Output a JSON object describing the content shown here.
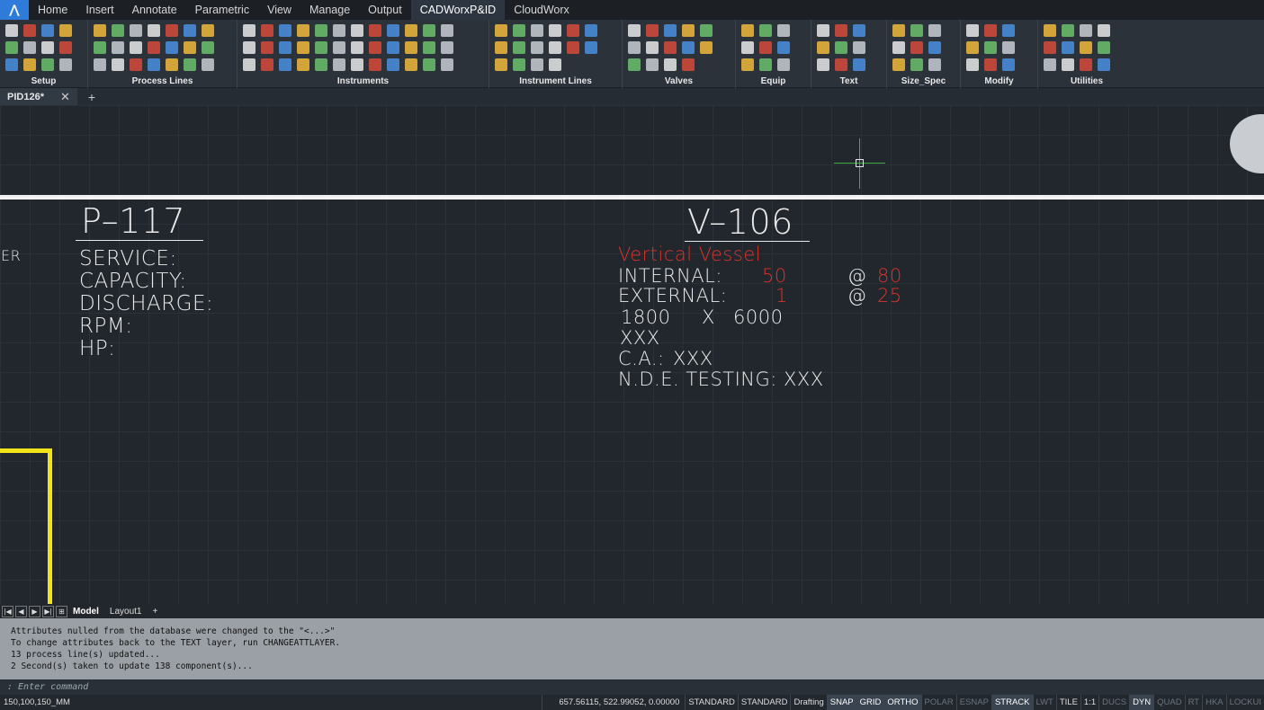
{
  "menu": {
    "logo": "⋀",
    "tabs": [
      "Home",
      "Insert",
      "Annotate",
      "Parametric",
      "View",
      "Manage",
      "Output",
      "CADWorxP&ID",
      "CloudWorx"
    ],
    "active_tab": "CADWorxP&ID"
  },
  "ribbon": {
    "groups": [
      "Setup",
      "Process Lines",
      "Instruments",
      "Instrument Lines",
      "Valves",
      "Equip",
      "Text",
      "Size_Spec",
      "Modify",
      "Utilities"
    ]
  },
  "doc_tabs": {
    "active": "PID126*",
    "close": "✕",
    "add": "+"
  },
  "drawing": {
    "pump": {
      "tag": "P–117",
      "lines": [
        "SERVICE:",
        "CAPACITY:",
        "DISCHARGE:",
        "RPM:",
        "HP:"
      ]
    },
    "left_fragment": "ER",
    "vessel": {
      "tag": "V–106",
      "type": "Vertical Vessel",
      "internal_label": "INTERNAL:",
      "internal_value": "50",
      "internal_at": "@",
      "internal_temp": "80",
      "external_label": "EXTERNAL:",
      "external_value": "1",
      "external_at": "@",
      "external_temp": "25",
      "dim_a": "1800",
      "dim_x": "X",
      "dim_b": "6000",
      "material": "XXX",
      "ca_label": "C.A.:",
      "ca_value": "XXX",
      "nde_label": "N.D.E. TESTING:",
      "nde_value": "XXX"
    },
    "colors": {
      "red": "#d9342b",
      "yellow": "#f2e21a",
      "white": "#e9e9e9",
      "crosshair": "#3fae3f"
    }
  },
  "layout_tabs": {
    "nav": [
      "|◀",
      "◀",
      "▶",
      "▶|",
      "⊞"
    ],
    "tabs": [
      "Model",
      "Layout1"
    ],
    "add": "+"
  },
  "command_history": [
    "Attributes nulled from the database were changed to the \"<...>\"",
    "To change attributes back to the TEXT layer, run CHANGEATTLAYER.",
    "13 process line(s) updated...",
    "2 Second(s) taken to update 138 component(s)..."
  ],
  "command_prompt": ": Enter command",
  "status": {
    "spec": "150,100,150_MM",
    "coords": "657.56115, 522.99052, 0.00000",
    "items": [
      {
        "label": "STANDARD",
        "state": "text"
      },
      {
        "label": "STANDARD",
        "state": "text"
      },
      {
        "label": "Drafting",
        "state": "text"
      },
      {
        "label": "SNAP",
        "state": "on"
      },
      {
        "label": "GRID",
        "state": "on"
      },
      {
        "label": "ORTHO",
        "state": "on"
      },
      {
        "label": "POLAR",
        "state": "off"
      },
      {
        "label": "ESNAP",
        "state": "off"
      },
      {
        "label": "STRACK",
        "state": "on"
      },
      {
        "label": "LWT",
        "state": "off"
      },
      {
        "label": "TILE",
        "state": "text"
      },
      {
        "label": "1:1",
        "state": "text"
      },
      {
        "label": "DUCS",
        "state": "off"
      },
      {
        "label": "DYN",
        "state": "on"
      },
      {
        "label": "QUAD",
        "state": "off"
      },
      {
        "label": "RT",
        "state": "off"
      },
      {
        "label": "HKA",
        "state": "off"
      },
      {
        "label": "LOCKUI",
        "state": "off"
      }
    ]
  }
}
